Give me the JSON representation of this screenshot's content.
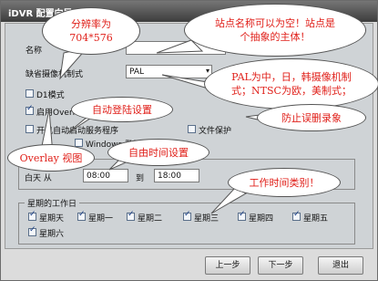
{
  "window": {
    "title": "iDVR 配置向导"
  },
  "form": {
    "name_label": "名称",
    "name_value": "",
    "camera_label": "缺省摄像机制式",
    "camera_value": "PAL",
    "d1_label": "D1模式",
    "overlay_label": "启用Overlay",
    "autostart_label": "开机自动启动服务程序",
    "fileprotect_label": "文件保护",
    "winlogin_label": "Windows 登录"
  },
  "time": {
    "all_day_label": "白天 从",
    "from_value": "08:00",
    "to_label": "到",
    "to_value": "18:00"
  },
  "workdays": {
    "title": "星期的工作日",
    "days": [
      {
        "label": "星期天",
        "checked": true
      },
      {
        "label": "星期一",
        "checked": true
      },
      {
        "label": "星期二",
        "checked": true
      },
      {
        "label": "星期三",
        "checked": true
      },
      {
        "label": "星期四",
        "checked": true
      },
      {
        "label": "星期五",
        "checked": true
      },
      {
        "label": "星期六",
        "checked": true
      }
    ]
  },
  "buttons": {
    "prev": "上一步",
    "next": "下一步",
    "exit": "退出"
  },
  "annotations": {
    "resolution": "分辨率为704*576",
    "station": "站点名称可以为空！站点是个抽象的主体！",
    "pal": "PAL为中，日，韩摄像机制式；NTSC为欧，美制式；",
    "autologin": "自动登陆设置",
    "protect": "防止误删录象",
    "overlay": "Overlay 视图",
    "timeset": "自由时间设置",
    "worktime": "工作时间类别！"
  },
  "colors": {
    "annotation_text": "#e0201a",
    "titlebar": "#4a4a4a"
  }
}
